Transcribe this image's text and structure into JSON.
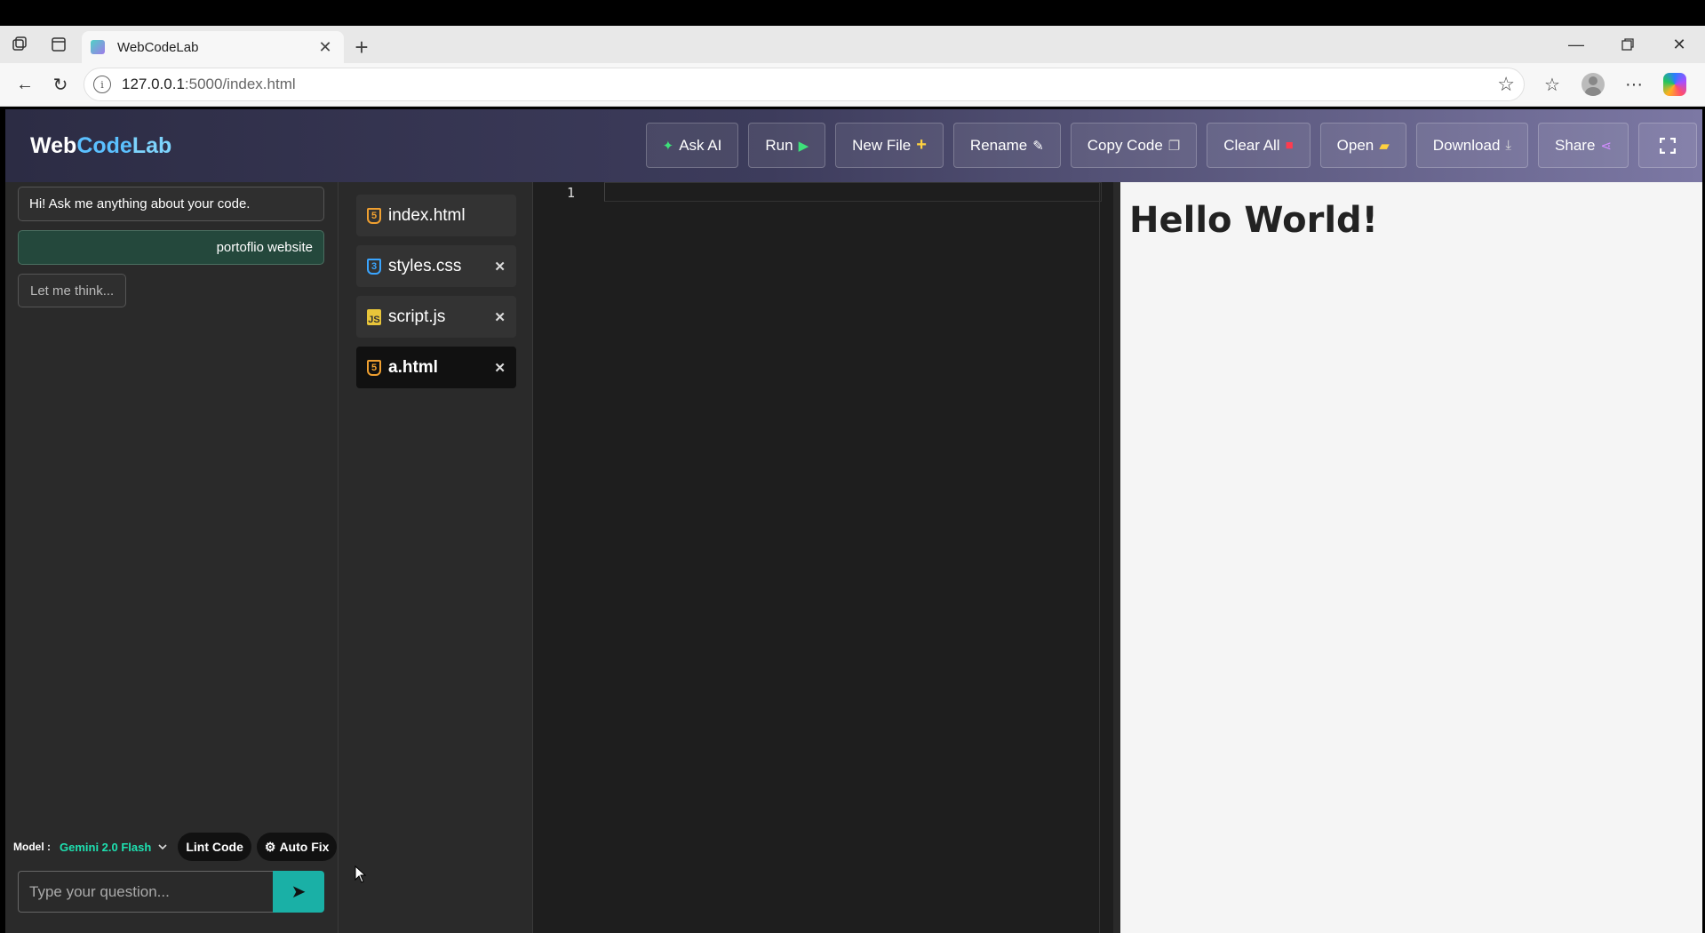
{
  "browser": {
    "tab_title": "WebCodeLab",
    "url_host": "127.0.0.1",
    "url_rest": ":5000/index.html"
  },
  "header": {
    "logo_web": "Web",
    "logo_code": "Code",
    "logo_lab": "Lab"
  },
  "toolbar": {
    "ask_ai": "Ask AI",
    "run": "Run",
    "new_file": "New File",
    "rename": "Rename",
    "copy_code": "Copy Code",
    "clear_all": "Clear All",
    "open": "Open",
    "download": "Download",
    "share": "Share"
  },
  "chat": {
    "messages": [
      {
        "role": "bot",
        "text": "Hi! Ask me anything about your code."
      },
      {
        "role": "user",
        "text": "portoflio website"
      },
      {
        "role": "bot",
        "text": "Let me think..."
      }
    ],
    "model_label": "Model :",
    "model_value": "Gemini 2.0 Flash",
    "lint_label": "Lint Code",
    "autofix_label": "Auto Fix",
    "input_placeholder": "Type your question..."
  },
  "files": [
    {
      "name": "index.html",
      "type": "html",
      "closable": false,
      "active": false
    },
    {
      "name": "styles.css",
      "type": "css",
      "closable": true,
      "active": false
    },
    {
      "name": "script.js",
      "type": "js",
      "closable": true,
      "active": false
    },
    {
      "name": "a.html",
      "type": "html",
      "closable": true,
      "active": true
    }
  ],
  "editor": {
    "line_numbers": [
      "1"
    ]
  },
  "preview": {
    "heading": "Hello World!"
  },
  "colors": {
    "accent": "#1ab0a6",
    "model_text": "#1ee0b0"
  }
}
